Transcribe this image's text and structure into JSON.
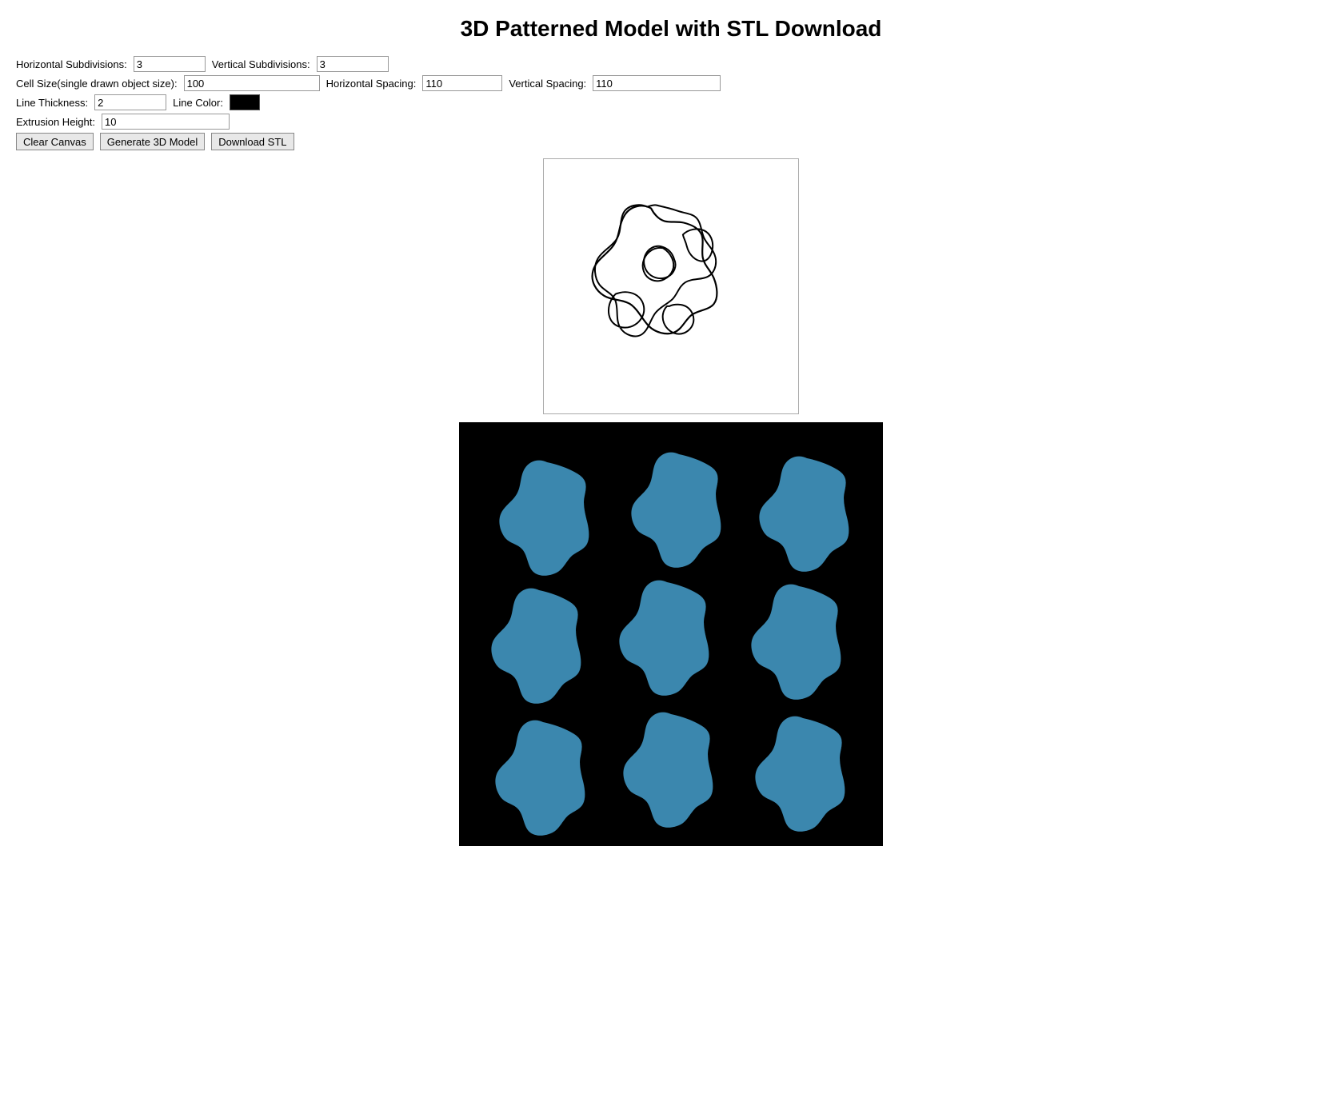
{
  "page": {
    "title": "3D Patterned Model with STL Download"
  },
  "controls": {
    "horizontal_subdivisions_label": "Horizontal Subdivisions:",
    "horizontal_subdivisions_value": "3",
    "vertical_subdivisions_label": "Vertical Subdivisions:",
    "vertical_subdivisions_value": "3",
    "cell_size_label": "Cell Size(single drawn object size):",
    "cell_size_value": "100",
    "horizontal_spacing_label": "Horizontal Spacing:",
    "horizontal_spacing_value": "110",
    "vertical_spacing_label": "Vertical Spacing:",
    "vertical_spacing_value": "110",
    "line_thickness_label": "Line Thickness:",
    "line_thickness_value": "2",
    "line_color_label": "Line Color:",
    "line_color_value": "#000000",
    "extrusion_height_label": "Extrusion Height:",
    "extrusion_height_value": "10"
  },
  "buttons": {
    "clear_canvas": "Clear Canvas",
    "generate_3d_model": "Generate 3D Model",
    "download_stl": "Download STL"
  }
}
